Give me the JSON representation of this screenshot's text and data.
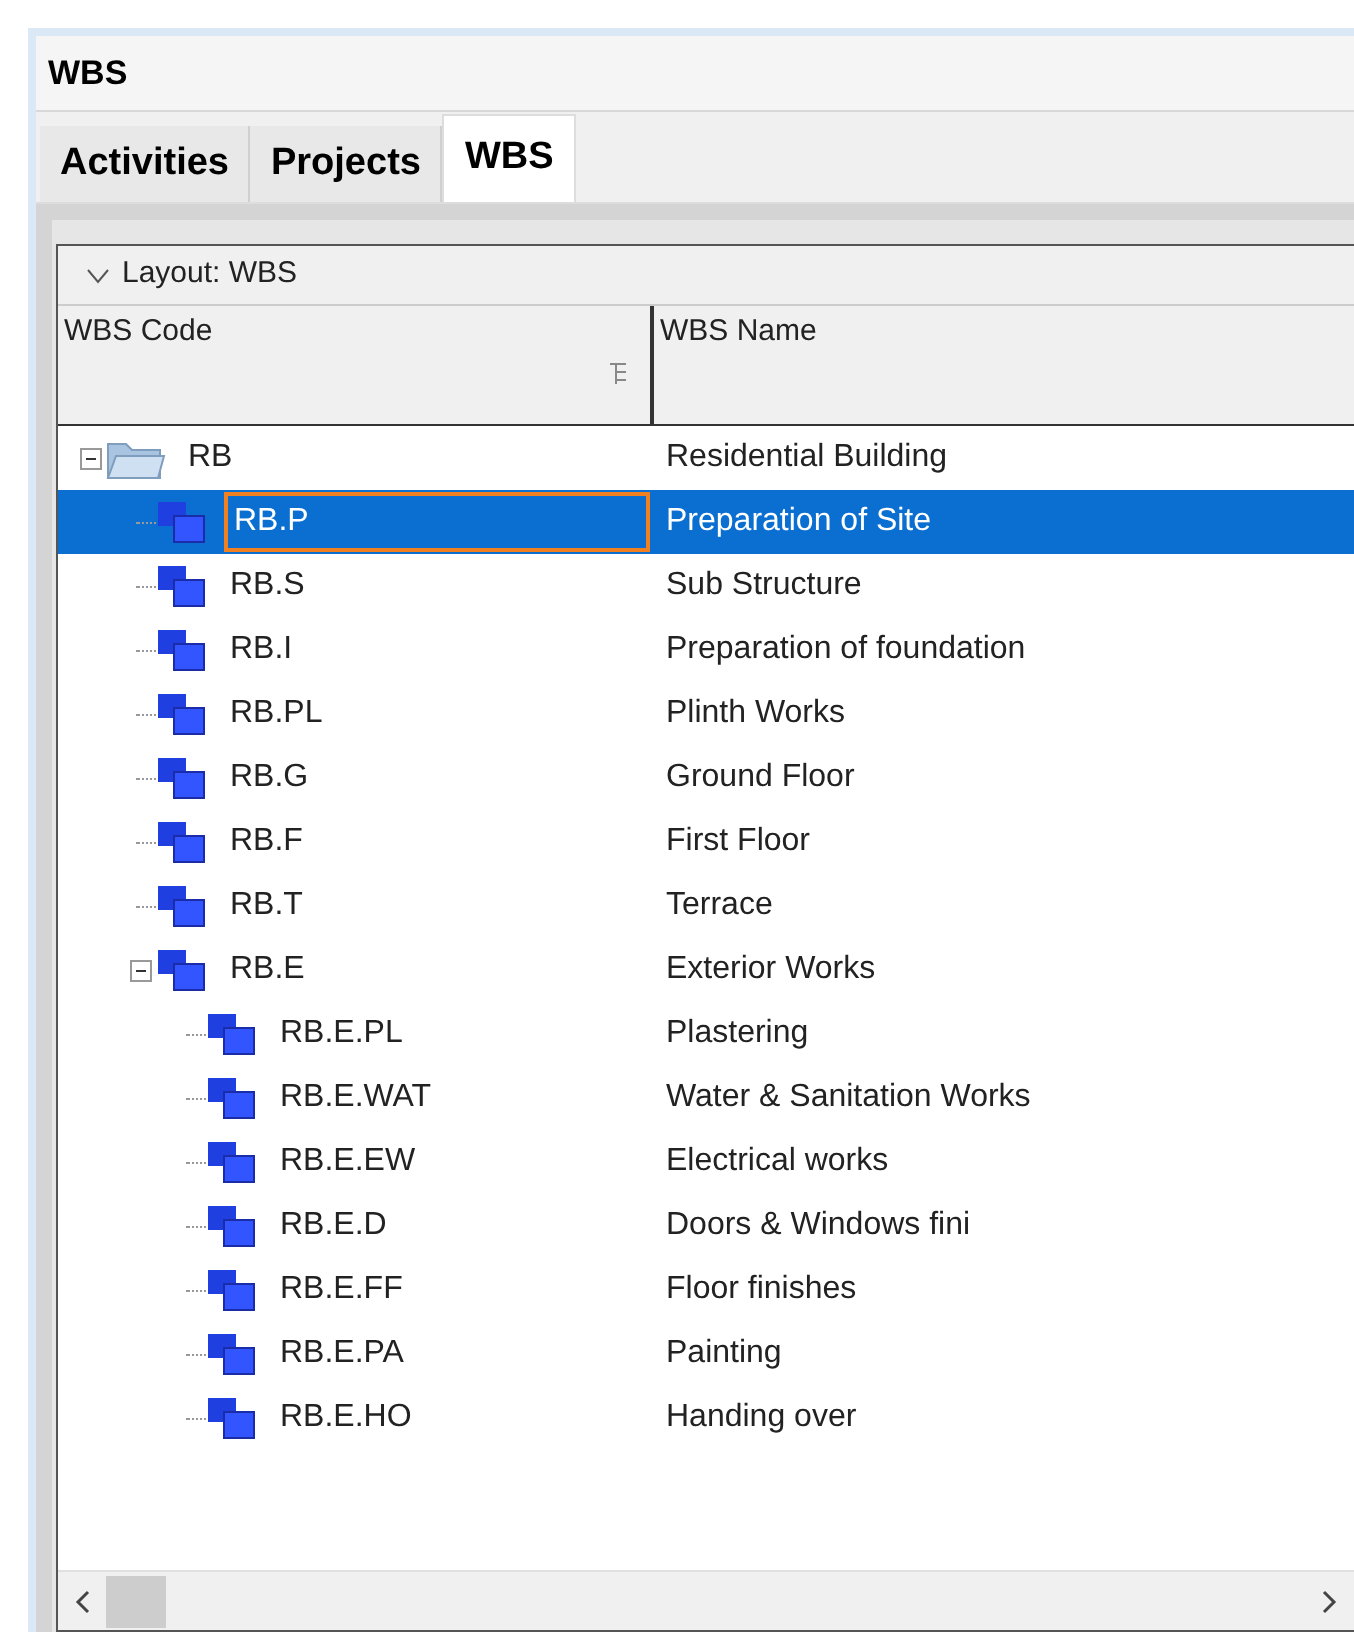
{
  "window": {
    "title": "WBS"
  },
  "tabs": [
    {
      "label": "Activities",
      "selected": false
    },
    {
      "label": "Projects",
      "selected": false
    },
    {
      "label": "WBS",
      "selected": true
    }
  ],
  "layout": {
    "label": "Layout: WBS"
  },
  "table": {
    "columns": [
      "WBS Code",
      "WBS Name"
    ],
    "rows": [
      {
        "kind": "folder",
        "code": "RB",
        "name": "Residential Building",
        "selected": false,
        "expanded": true,
        "children": [
          {
            "kind": "wbs",
            "code": "RB.P",
            "name": "Preparation of Site",
            "selected": true
          },
          {
            "kind": "wbs",
            "code": "RB.S",
            "name": "Sub Structure",
            "selected": false
          },
          {
            "kind": "wbs",
            "code": "RB.I",
            "name": "Preparation of foundation",
            "selected": false
          },
          {
            "kind": "wbs",
            "code": "RB.PL",
            "name": "Plinth Works",
            "selected": false
          },
          {
            "kind": "wbs",
            "code": "RB.G",
            "name": "Ground Floor",
            "selected": false
          },
          {
            "kind": "wbs",
            "code": "RB.F",
            "name": "First Floor",
            "selected": false
          },
          {
            "kind": "wbs",
            "code": "RB.T",
            "name": "Terrace",
            "selected": false
          },
          {
            "kind": "wbs",
            "code": "RB.E",
            "name": "Exterior Works",
            "selected": false,
            "expanded": true,
            "children": [
              {
                "kind": "wbs",
                "code": "RB.E.PL",
                "name": "Plastering",
                "selected": false
              },
              {
                "kind": "wbs",
                "code": "RB.E.WAT",
                "name": "Water & Sanitation Works",
                "selected": false
              },
              {
                "kind": "wbs",
                "code": "RB.E.EW",
                "name": "Electrical works",
                "selected": false
              },
              {
                "kind": "wbs",
                "code": "RB.E.D",
                "name": "Doors & Windows fini",
                "selected": false
              },
              {
                "kind": "wbs",
                "code": "RB.E.FF",
                "name": "Floor finishes",
                "selected": false
              },
              {
                "kind": "wbs",
                "code": "RB.E.PA",
                "name": "Painting",
                "selected": false
              },
              {
                "kind": "wbs",
                "code": "RB.E.HO",
                "name": "Handing over",
                "selected": false
              }
            ]
          }
        ]
      }
    ]
  }
}
